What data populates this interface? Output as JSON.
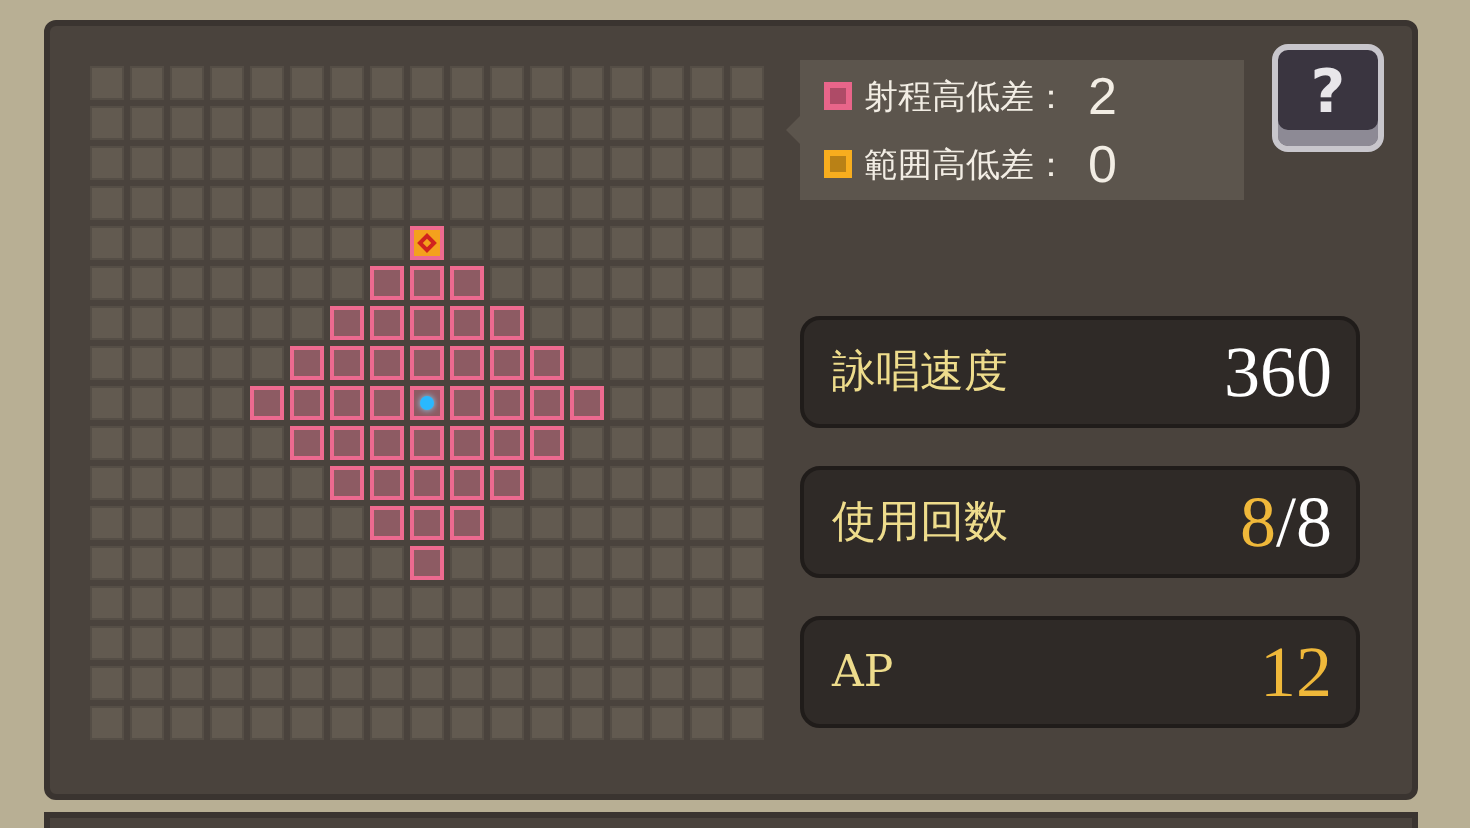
{
  "range_grid": {
    "rows": [
      [
        {
          "kind": "empty"
        },
        {
          "kind": "empty"
        },
        {
          "kind": "empty"
        },
        {
          "kind": "empty"
        },
        {
          "kind": "empty"
        },
        {
          "kind": "empty"
        },
        {
          "kind": "empty"
        },
        {
          "kind": "empty"
        },
        {
          "kind": "empty"
        },
        {
          "kind": "empty"
        },
        {
          "kind": "empty"
        },
        {
          "kind": "empty"
        },
        {
          "kind": "empty"
        },
        {
          "kind": "empty"
        },
        {
          "kind": "empty"
        },
        {
          "kind": "empty"
        },
        {
          "kind": "empty"
        }
      ],
      [
        {
          "kind": "empty"
        },
        {
          "kind": "empty"
        },
        {
          "kind": "empty"
        },
        {
          "kind": "empty"
        },
        {
          "kind": "empty"
        },
        {
          "kind": "empty"
        },
        {
          "kind": "empty"
        },
        {
          "kind": "empty"
        },
        {
          "kind": "empty"
        },
        {
          "kind": "empty"
        },
        {
          "kind": "empty"
        },
        {
          "kind": "empty"
        },
        {
          "kind": "empty"
        },
        {
          "kind": "empty"
        },
        {
          "kind": "empty"
        },
        {
          "kind": "empty"
        },
        {
          "kind": "empty"
        }
      ],
      [
        {
          "kind": "empty"
        },
        {
          "kind": "empty"
        },
        {
          "kind": "empty"
        },
        {
          "kind": "empty"
        },
        {
          "kind": "empty"
        },
        {
          "kind": "empty"
        },
        {
          "kind": "empty"
        },
        {
          "kind": "empty"
        },
        {
          "kind": "empty"
        },
        {
          "kind": "empty"
        },
        {
          "kind": "empty"
        },
        {
          "kind": "empty"
        },
        {
          "kind": "empty"
        },
        {
          "kind": "empty"
        },
        {
          "kind": "empty"
        },
        {
          "kind": "empty"
        },
        {
          "kind": "empty"
        }
      ],
      [
        {
          "kind": "empty"
        },
        {
          "kind": "empty"
        },
        {
          "kind": "empty"
        },
        {
          "kind": "empty"
        },
        {
          "kind": "empty"
        },
        {
          "kind": "empty"
        },
        {
          "kind": "empty"
        },
        {
          "kind": "empty"
        },
        {
          "kind": "empty"
        },
        {
          "kind": "empty"
        },
        {
          "kind": "empty"
        },
        {
          "kind": "empty"
        },
        {
          "kind": "empty"
        },
        {
          "kind": "empty"
        },
        {
          "kind": "empty"
        },
        {
          "kind": "empty"
        },
        {
          "kind": "empty"
        }
      ],
      [
        {
          "kind": "empty"
        },
        {
          "kind": "empty"
        },
        {
          "kind": "empty"
        },
        {
          "kind": "empty"
        },
        {
          "kind": "empty"
        },
        {
          "kind": "empty"
        },
        {
          "kind": "empty"
        },
        {
          "kind": "empty"
        },
        {
          "kind": "target"
        },
        {
          "kind": "empty"
        },
        {
          "kind": "empty"
        },
        {
          "kind": "empty"
        },
        {
          "kind": "empty"
        },
        {
          "kind": "empty"
        },
        {
          "kind": "empty"
        },
        {
          "kind": "empty"
        },
        {
          "kind": "empty"
        }
      ],
      [
        {
          "kind": "empty"
        },
        {
          "kind": "empty"
        },
        {
          "kind": "empty"
        },
        {
          "kind": "empty"
        },
        {
          "kind": "empty"
        },
        {
          "kind": "empty"
        },
        {
          "kind": "empty"
        },
        {
          "kind": "range"
        },
        {
          "kind": "range"
        },
        {
          "kind": "range"
        },
        {
          "kind": "empty"
        },
        {
          "kind": "empty"
        },
        {
          "kind": "empty"
        },
        {
          "kind": "empty"
        },
        {
          "kind": "empty"
        },
        {
          "kind": "empty"
        },
        {
          "kind": "empty"
        }
      ],
      [
        {
          "kind": "empty"
        },
        {
          "kind": "empty"
        },
        {
          "kind": "empty"
        },
        {
          "kind": "empty"
        },
        {
          "kind": "empty"
        },
        {
          "kind": "empty"
        },
        {
          "kind": "range"
        },
        {
          "kind": "range"
        },
        {
          "kind": "range"
        },
        {
          "kind": "range"
        },
        {
          "kind": "range"
        },
        {
          "kind": "empty"
        },
        {
          "kind": "empty"
        },
        {
          "kind": "empty"
        },
        {
          "kind": "empty"
        },
        {
          "kind": "empty"
        },
        {
          "kind": "empty"
        }
      ],
      [
        {
          "kind": "empty"
        },
        {
          "kind": "empty"
        },
        {
          "kind": "empty"
        },
        {
          "kind": "empty"
        },
        {
          "kind": "empty"
        },
        {
          "kind": "range"
        },
        {
          "kind": "range"
        },
        {
          "kind": "range"
        },
        {
          "kind": "range"
        },
        {
          "kind": "range"
        },
        {
          "kind": "range"
        },
        {
          "kind": "range"
        },
        {
          "kind": "empty"
        },
        {
          "kind": "empty"
        },
        {
          "kind": "empty"
        },
        {
          "kind": "empty"
        },
        {
          "kind": "empty"
        }
      ],
      [
        {
          "kind": "empty"
        },
        {
          "kind": "empty"
        },
        {
          "kind": "empty"
        },
        {
          "kind": "empty"
        },
        {
          "kind": "range"
        },
        {
          "kind": "range"
        },
        {
          "kind": "range"
        },
        {
          "kind": "range"
        },
        {
          "kind": "caster"
        },
        {
          "kind": "range"
        },
        {
          "kind": "range"
        },
        {
          "kind": "range"
        },
        {
          "kind": "range"
        },
        {
          "kind": "empty"
        },
        {
          "kind": "empty"
        },
        {
          "kind": "empty"
        },
        {
          "kind": "empty"
        }
      ],
      [
        {
          "kind": "empty"
        },
        {
          "kind": "empty"
        },
        {
          "kind": "empty"
        },
        {
          "kind": "empty"
        },
        {
          "kind": "empty"
        },
        {
          "kind": "range"
        },
        {
          "kind": "range"
        },
        {
          "kind": "range"
        },
        {
          "kind": "range"
        },
        {
          "kind": "range"
        },
        {
          "kind": "range"
        },
        {
          "kind": "range"
        },
        {
          "kind": "empty"
        },
        {
          "kind": "empty"
        },
        {
          "kind": "empty"
        },
        {
          "kind": "empty"
        },
        {
          "kind": "empty"
        }
      ],
      [
        {
          "kind": "empty"
        },
        {
          "kind": "empty"
        },
        {
          "kind": "empty"
        },
        {
          "kind": "empty"
        },
        {
          "kind": "empty"
        },
        {
          "kind": "empty"
        },
        {
          "kind": "range"
        },
        {
          "kind": "range"
        },
        {
          "kind": "range"
        },
        {
          "kind": "range"
        },
        {
          "kind": "range"
        },
        {
          "kind": "empty"
        },
        {
          "kind": "empty"
        },
        {
          "kind": "empty"
        },
        {
          "kind": "empty"
        },
        {
          "kind": "empty"
        },
        {
          "kind": "empty"
        }
      ],
      [
        {
          "kind": "empty"
        },
        {
          "kind": "empty"
        },
        {
          "kind": "empty"
        },
        {
          "kind": "empty"
        },
        {
          "kind": "empty"
        },
        {
          "kind": "empty"
        },
        {
          "kind": "empty"
        },
        {
          "kind": "range"
        },
        {
          "kind": "range"
        },
        {
          "kind": "range"
        },
        {
          "kind": "empty"
        },
        {
          "kind": "empty"
        },
        {
          "kind": "empty"
        },
        {
          "kind": "empty"
        },
        {
          "kind": "empty"
        },
        {
          "kind": "empty"
        },
        {
          "kind": "empty"
        }
      ],
      [
        {
          "kind": "empty"
        },
        {
          "kind": "empty"
        },
        {
          "kind": "empty"
        },
        {
          "kind": "empty"
        },
        {
          "kind": "empty"
        },
        {
          "kind": "empty"
        },
        {
          "kind": "empty"
        },
        {
          "kind": "empty"
        },
        {
          "kind": "range"
        },
        {
          "kind": "empty"
        },
        {
          "kind": "empty"
        },
        {
          "kind": "empty"
        },
        {
          "kind": "empty"
        },
        {
          "kind": "empty"
        },
        {
          "kind": "empty"
        },
        {
          "kind": "empty"
        },
        {
          "kind": "empty"
        }
      ],
      [
        {
          "kind": "empty"
        },
        {
          "kind": "empty"
        },
        {
          "kind": "empty"
        },
        {
          "kind": "empty"
        },
        {
          "kind": "empty"
        },
        {
          "kind": "empty"
        },
        {
          "kind": "empty"
        },
        {
          "kind": "empty"
        },
        {
          "kind": "empty"
        },
        {
          "kind": "empty"
        },
        {
          "kind": "empty"
        },
        {
          "kind": "empty"
        },
        {
          "kind": "empty"
        },
        {
          "kind": "empty"
        },
        {
          "kind": "empty"
        },
        {
          "kind": "empty"
        },
        {
          "kind": "empty"
        }
      ],
      [
        {
          "kind": "empty"
        },
        {
          "kind": "empty"
        },
        {
          "kind": "empty"
        },
        {
          "kind": "empty"
        },
        {
          "kind": "empty"
        },
        {
          "kind": "empty"
        },
        {
          "kind": "empty"
        },
        {
          "kind": "empty"
        },
        {
          "kind": "empty"
        },
        {
          "kind": "empty"
        },
        {
          "kind": "empty"
        },
        {
          "kind": "empty"
        },
        {
          "kind": "empty"
        },
        {
          "kind": "empty"
        },
        {
          "kind": "empty"
        },
        {
          "kind": "empty"
        },
        {
          "kind": "empty"
        }
      ],
      [
        {
          "kind": "empty"
        },
        {
          "kind": "empty"
        },
        {
          "kind": "empty"
        },
        {
          "kind": "empty"
        },
        {
          "kind": "empty"
        },
        {
          "kind": "empty"
        },
        {
          "kind": "empty"
        },
        {
          "kind": "empty"
        },
        {
          "kind": "empty"
        },
        {
          "kind": "empty"
        },
        {
          "kind": "empty"
        },
        {
          "kind": "empty"
        },
        {
          "kind": "empty"
        },
        {
          "kind": "empty"
        },
        {
          "kind": "empty"
        },
        {
          "kind": "empty"
        },
        {
          "kind": "empty"
        }
      ],
      [
        {
          "kind": "empty"
        },
        {
          "kind": "empty"
        },
        {
          "kind": "empty"
        },
        {
          "kind": "empty"
        },
        {
          "kind": "empty"
        },
        {
          "kind": "empty"
        },
        {
          "kind": "empty"
        },
        {
          "kind": "empty"
        },
        {
          "kind": "empty"
        },
        {
          "kind": "empty"
        },
        {
          "kind": "empty"
        },
        {
          "kind": "empty"
        },
        {
          "kind": "empty"
        },
        {
          "kind": "empty"
        },
        {
          "kind": "empty"
        },
        {
          "kind": "empty"
        },
        {
          "kind": "empty"
        }
      ]
    ]
  },
  "legend": {
    "items": [
      {
        "label": "射程高低差：",
        "value": "2",
        "color": "#e8658a"
      },
      {
        "label": "範囲高低差：",
        "value": "0",
        "color": "#f7ad1e"
      }
    ]
  },
  "help_button": {
    "label": "?"
  },
  "stats": [
    {
      "label": "詠唱速度",
      "value_parts": [
        {
          "text": "360",
          "highlighted": false
        }
      ]
    },
    {
      "label": "使用回数",
      "value_parts": [
        {
          "text": "8",
          "highlighted": true
        },
        {
          "text": "/8",
          "highlighted": false
        }
      ]
    },
    {
      "label": "AP",
      "value_parts": [
        {
          "text": "12",
          "highlighted": true
        }
      ]
    }
  ]
}
